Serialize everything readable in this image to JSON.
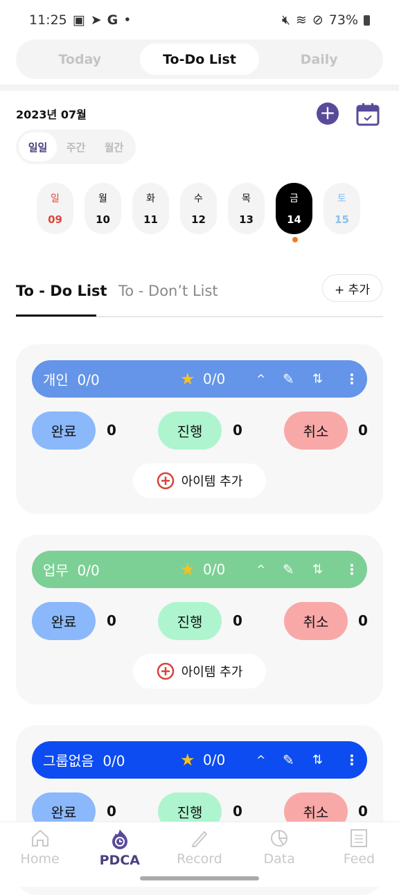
{
  "status_bar": {
    "time": "11:25",
    "battery": "73%"
  },
  "top_tabs": [
    {
      "label": "Today"
    },
    {
      "label": "To-Do List",
      "active": true
    },
    {
      "label": "Daily"
    }
  ],
  "month": "2023년 07월",
  "view_toggle": [
    {
      "label": "일일",
      "active": true
    },
    {
      "label": "주간"
    },
    {
      "label": "월간"
    }
  ],
  "days": [
    {
      "dow": "일",
      "date": "09",
      "color": "#e0463c"
    },
    {
      "dow": "월",
      "date": "10"
    },
    {
      "dow": "화",
      "date": "11"
    },
    {
      "dow": "수",
      "date": "12"
    },
    {
      "dow": "목",
      "date": "13"
    },
    {
      "dow": "금",
      "date": "14",
      "selected": true
    },
    {
      "dow": "토",
      "date": "15",
      "color": "#8fbfe8"
    }
  ],
  "list_tabs": {
    "todo": "To - Do List",
    "dont": "To - Don’t List",
    "add": "+ 추가"
  },
  "groups": [
    {
      "name": "개인",
      "progress": "0/0",
      "star": "0/0",
      "color": "#6495e8",
      "done": "0",
      "doing": "0",
      "cancel": "0"
    },
    {
      "name": "업무",
      "progress": "0/0",
      "star": "0/0",
      "color": "#7dd095",
      "done": "0",
      "doing": "0",
      "cancel": "0"
    },
    {
      "name": "그룹없음",
      "progress": "0/0",
      "star": "0/0",
      "color": "#0c4cf0",
      "done": "0",
      "doing": "0",
      "cancel": "0"
    }
  ],
  "status_labels": {
    "done": "완료",
    "doing": "진행",
    "cancel": "취소",
    "add_item": "아이템 추가"
  },
  "status_colors": {
    "done": "#8ab8fb",
    "doing": "#aef5cf",
    "cancel": "#f9a8a8"
  },
  "nav": [
    {
      "label": "Home",
      "icon": "home-icon"
    },
    {
      "label": "PDCA",
      "icon": "pdca-flame-icon",
      "active": true
    },
    {
      "label": "Record",
      "icon": "pencil-icon"
    },
    {
      "label": "Data",
      "icon": "pie-chart-icon"
    },
    {
      "label": "Feed",
      "icon": "list-icon"
    }
  ]
}
